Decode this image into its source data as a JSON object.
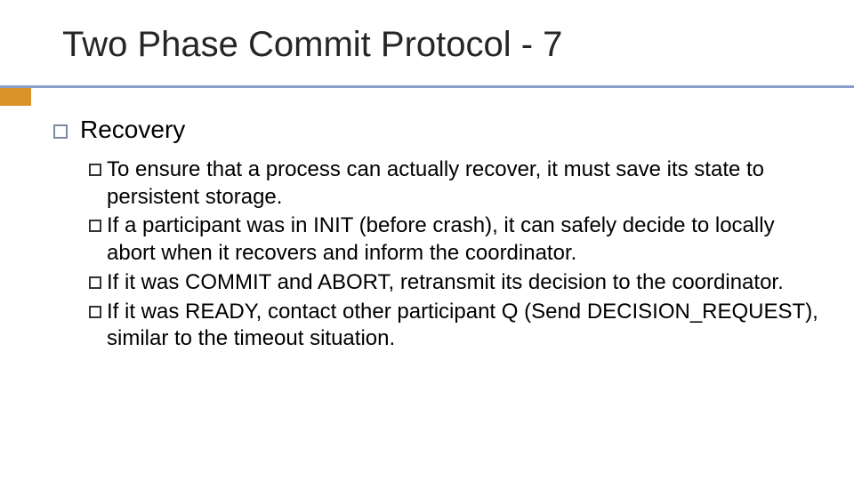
{
  "title": "Two Phase Commit Protocol - 7",
  "heading": "Recovery",
  "points": [
    "To ensure that a process can actually recover, it must save its state to persistent storage.",
    "If a participant was in INIT (before crash), it can safely decide to locally abort when it recovers and inform the coordinator.",
    "If it was COMMIT and ABORT, retransmit its decision to the coordinator.",
    "If it was READY, contact other participant Q (Send DECISION_REQUEST), similar to the timeout situation."
  ],
  "colors": {
    "rule": "#8aa0c8",
    "accent": "#d8942a"
  }
}
